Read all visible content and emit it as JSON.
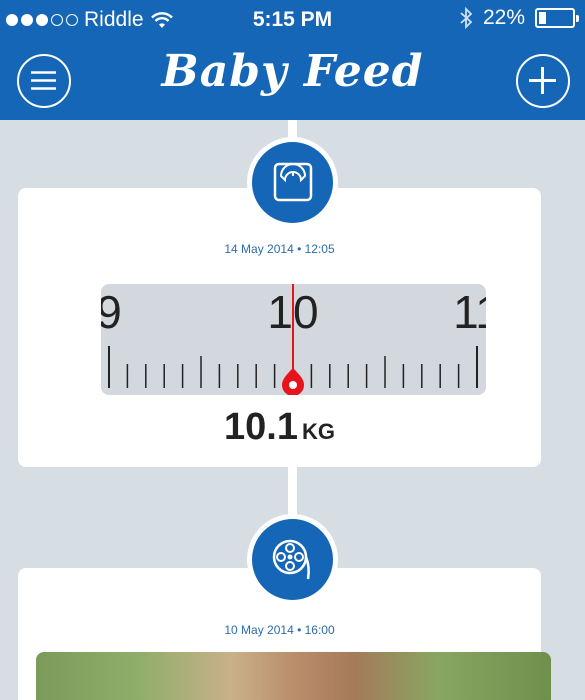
{
  "status_bar": {
    "carrier": "Riddle",
    "time": "5:15 PM",
    "battery_text": "22%",
    "battery_level": 0.22,
    "signal_bars_filled": 3,
    "signal_bars_total": 5
  },
  "header": {
    "title": "Baby Feed",
    "menu_icon": "hamburger-menu-icon",
    "add_icon": "plus-icon",
    "color": "#1566b6"
  },
  "entries": [
    {
      "type": "weight",
      "icon": "bathroom-scale-icon",
      "date": "14 May 2014 • 12:05",
      "scale_labels": [
        "9",
        "10",
        "11"
      ],
      "weight_value": "10.1",
      "weight_unit": "KG",
      "weight_numeric": 10.1
    },
    {
      "type": "video",
      "icon": "film-reel-icon",
      "date": "10 May 2014 • 16:00"
    }
  ],
  "accent_colors": {
    "primary": "#1566b6",
    "indicator": "#e8141b",
    "background": "#d6dde3"
  }
}
